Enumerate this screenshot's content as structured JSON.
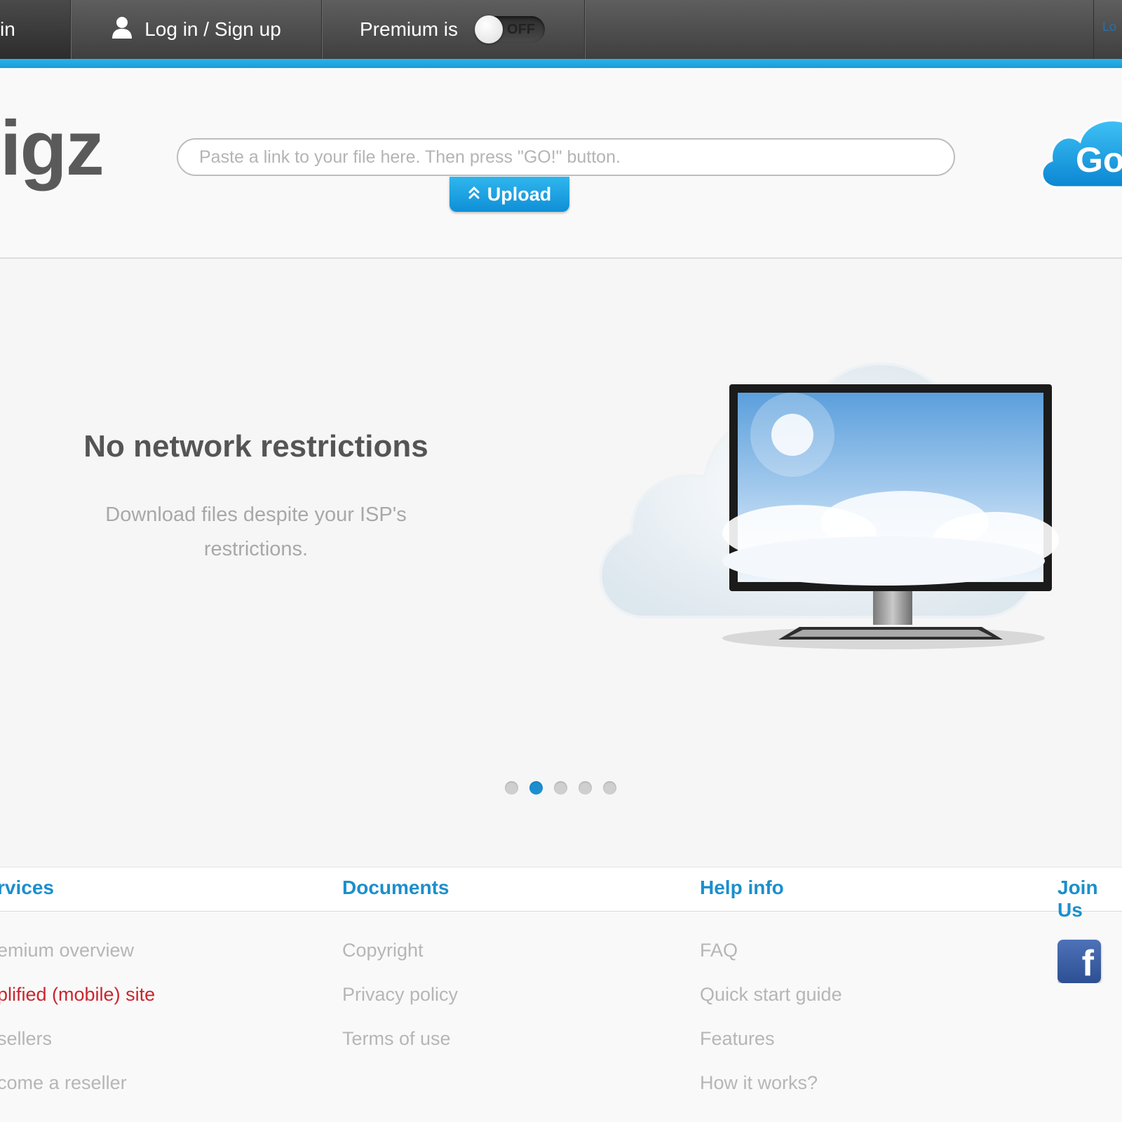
{
  "topbar": {
    "partial_left_text": "in",
    "login_label": "Log in / Sign up",
    "premium_label": "Premium is",
    "premium_toggle_state": "OFF",
    "right_partial_text": "Lo"
  },
  "header": {
    "logo_text": "igz",
    "link_placeholder": "Paste a link to your file here. Then press \"GO!\" button.",
    "upload_label": "Upload",
    "go_label": "Go"
  },
  "hero": {
    "title": "No network restrictions",
    "text": "Download files despite your ISP's restrictions.",
    "slides_count": 5,
    "active_slide": 2
  },
  "footer": {
    "columns": [
      {
        "title": "rvices",
        "items": [
          {
            "label": "emium overview",
            "highlight": false
          },
          {
            "label": "plified (mobile) site",
            "highlight": true
          },
          {
            "label": "sellers",
            "highlight": false
          },
          {
            "label": "come a reseller",
            "highlight": false
          }
        ]
      },
      {
        "title": "Documents",
        "items": [
          {
            "label": "Copyright",
            "highlight": false
          },
          {
            "label": "Privacy policy",
            "highlight": false
          },
          {
            "label": "Terms of use",
            "highlight": false
          }
        ]
      },
      {
        "title": "Help info",
        "items": [
          {
            "label": "FAQ",
            "highlight": false
          },
          {
            "label": "Quick start guide",
            "highlight": false
          },
          {
            "label": "Features",
            "highlight": false
          },
          {
            "label": "How it works?",
            "highlight": false
          }
        ]
      },
      {
        "title": "Join Us",
        "items": []
      }
    ],
    "facebook_letter": "f"
  },
  "colors": {
    "accent_blue": "#1b8fcc",
    "highlight_red": "#c8272d",
    "topbar": "#4a4a4a"
  },
  "icons": [
    "user-icon",
    "upload-chevron-icon",
    "facebook-icon",
    "go-cloud-icon",
    "cloud-monitor-illustration"
  ]
}
